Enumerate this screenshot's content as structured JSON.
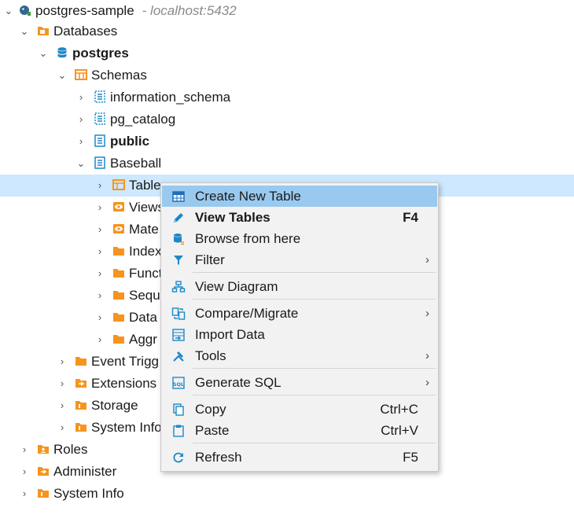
{
  "tree": {
    "connection": {
      "name": "postgres-sample",
      "host": "- localhost:5432"
    },
    "databases_label": "Databases",
    "db_name": "postgres",
    "schemas_label": "Schemas",
    "schemas": [
      {
        "name": "information_schema"
      },
      {
        "name": "pg_catalog"
      },
      {
        "name": "public"
      },
      {
        "name": "Baseball"
      }
    ],
    "baseball_children": [
      "Table",
      "Views",
      "Mate",
      "Index",
      "Funct",
      "Sequ",
      "Data",
      "Aggr"
    ],
    "db_children": [
      "Event Trigg",
      "Extensions",
      "Storage",
      "System Info"
    ],
    "root_children": [
      "Roles",
      "Administer",
      "System Info"
    ]
  },
  "menu": {
    "items": [
      {
        "label": "Create New Table",
        "shortcut": "",
        "icon": "table-add-icon"
      },
      {
        "label": "View Tables",
        "shortcut": "F4",
        "icon": "edit-pencil-icon"
      },
      {
        "label": "Browse from here",
        "shortcut": "",
        "icon": "database-browse-icon"
      },
      {
        "label": "Filter",
        "shortcut": "",
        "icon": "filter-icon"
      },
      {
        "label": "View Diagram",
        "shortcut": "",
        "icon": "diagram-icon"
      },
      {
        "label": "Compare/Migrate",
        "shortcut": "",
        "icon": "compare-icon"
      },
      {
        "label": "Import Data",
        "shortcut": "",
        "icon": "import-icon"
      },
      {
        "label": "Tools",
        "shortcut": "",
        "icon": "tools-icon"
      },
      {
        "label": "Generate SQL",
        "shortcut": "",
        "icon": "sql-icon"
      },
      {
        "label": "Copy",
        "shortcut": "Ctrl+C",
        "icon": "copy-icon"
      },
      {
        "label": "Paste",
        "shortcut": "Ctrl+V",
        "icon": "paste-icon"
      },
      {
        "label": "Refresh",
        "shortcut": "F5",
        "icon": "refresh-icon"
      }
    ],
    "submenu_arrow": "›"
  },
  "colors": {
    "selection": "#cde8ff",
    "menu_highlight": "#99c9ef",
    "folder": "#f7941d",
    "db": "#1e88c7"
  }
}
